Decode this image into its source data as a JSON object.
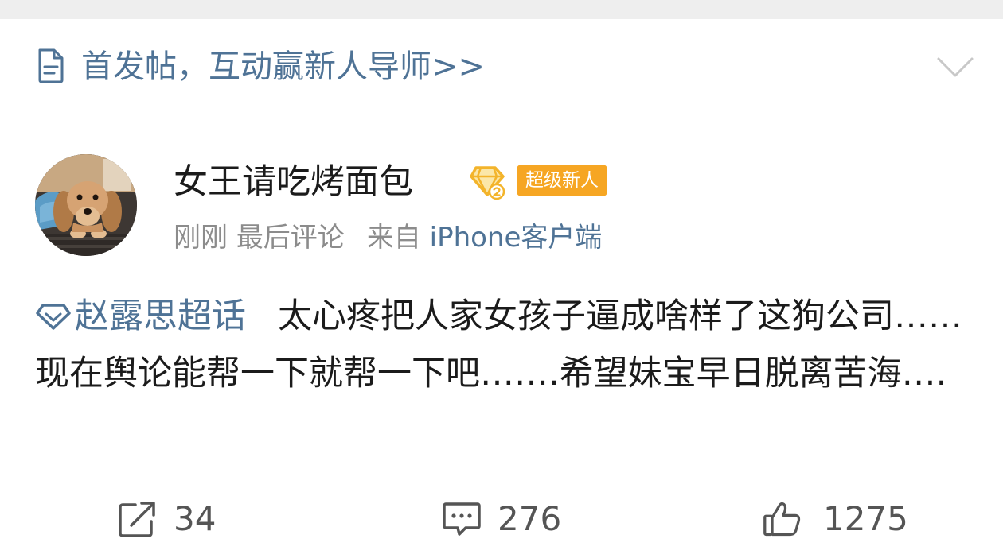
{
  "notice": {
    "icon": "document-icon",
    "text": "首发帖，互动赢新人导师>>",
    "collapse_icon": "chevron-down-icon"
  },
  "post": {
    "author": {
      "avatar": "avatar-dachshund-puppy",
      "name": "女王请吃烤面包",
      "vip_icon": "vip-diamond-level-2-icon",
      "badge": "超级新人"
    },
    "meta": {
      "time": "刚刚",
      "action": "最后评论",
      "source_prefix": "来自",
      "source": "iPhone客户端"
    },
    "topic": {
      "icon": "supertopic-diamond-icon",
      "label": "赵露思超话"
    },
    "body": "太心疼把人家女孩子逼成啥样了这狗公司……现在舆论能帮一下就帮一下吧…….希望妹宝早日脱离苦海…."
  },
  "actions": {
    "repost": {
      "icon": "repost-icon",
      "count": "34"
    },
    "comment": {
      "icon": "comment-icon",
      "count": "276"
    },
    "like": {
      "icon": "thumbs-up-icon",
      "count": "1275"
    }
  },
  "colors": {
    "link_blue": "#4f7396",
    "badge_orange": "#f6a623",
    "meta_gray": "#8c8c8c",
    "text_black": "#1b1b1b"
  }
}
